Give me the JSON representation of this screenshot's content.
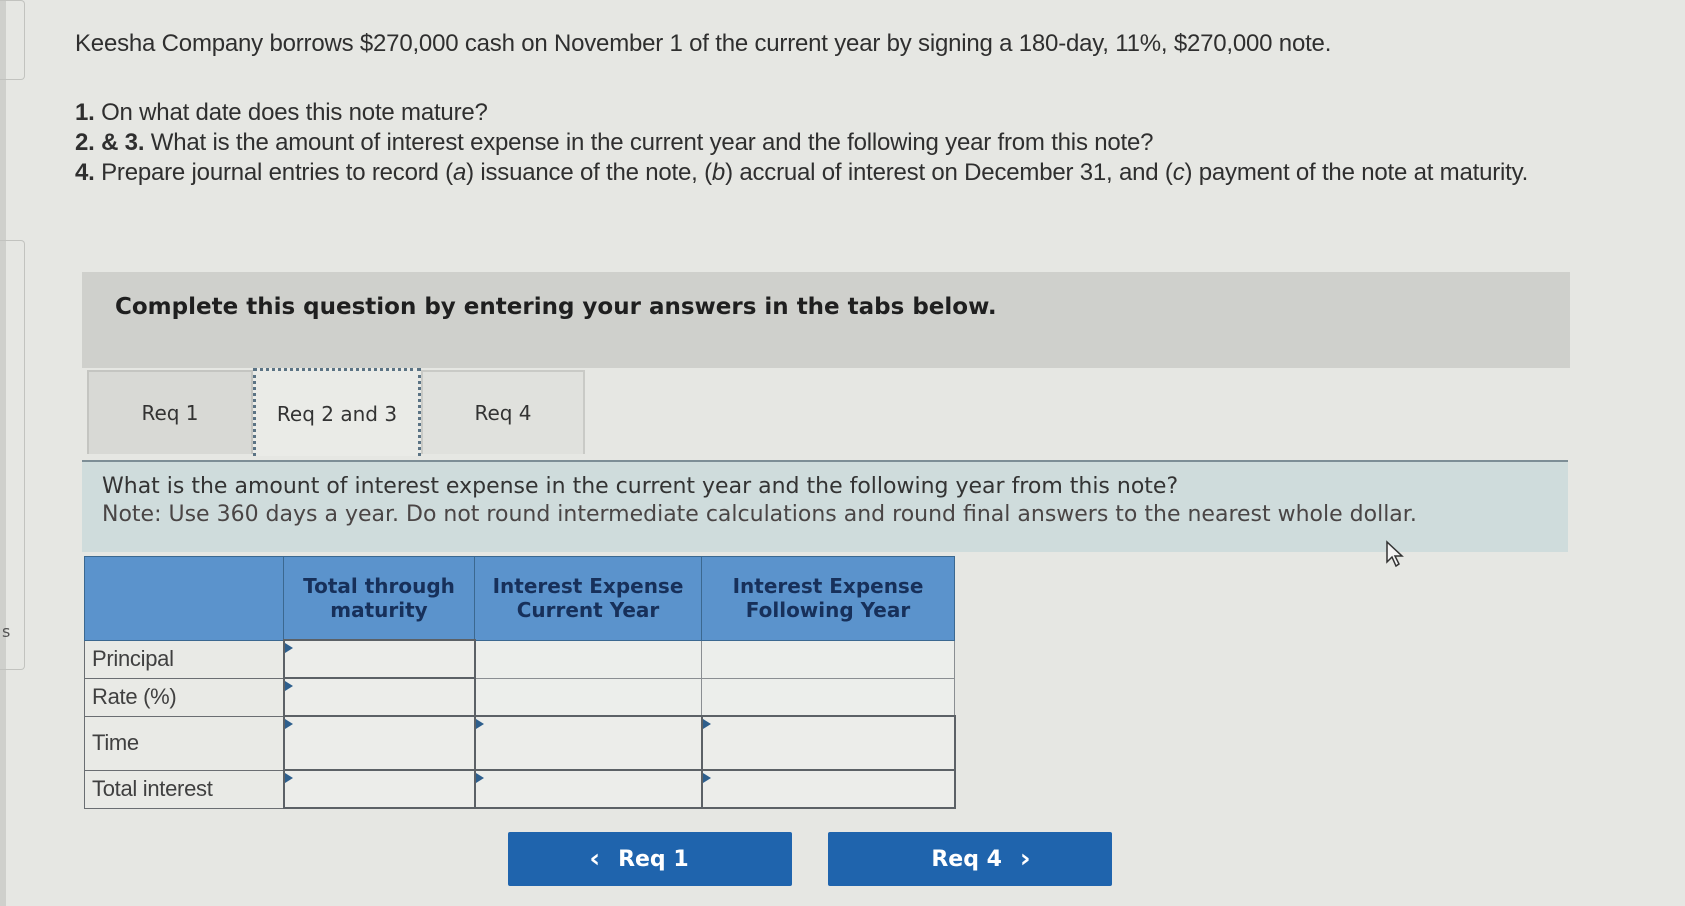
{
  "problem": {
    "intro": "Keesha Company borrows $270,000 cash on November 1 of the current year by signing a 180-day, 11%, $270,000 note.",
    "questions": [
      {
        "num": "1.",
        "text": "On what date does this note mature?"
      },
      {
        "num": "2. & 3.",
        "text": "What is the amount of interest expense in the current year and the following year from this note?"
      },
      {
        "num": "4.",
        "text_parts": [
          "Prepare journal entries to record (",
          "a",
          ") issuance of the note, (",
          "b",
          ") accrual of interest on December 31, and (",
          "c",
          ") payment of the note at maturity."
        ]
      }
    ]
  },
  "instructions": "Complete this question by entering your answers in the tabs below.",
  "tabs": [
    {
      "label": "Req 1",
      "active": false
    },
    {
      "label": "Req 2 and 3",
      "active": true
    },
    {
      "label": "Req 4",
      "active": false
    }
  ],
  "question_panel": {
    "prompt": "What is the amount of interest expense in the current year and the following year from this note?",
    "note": "Note: Use 360 days a year. Do not round intermediate calculations and round final answers to the nearest whole dollar."
  },
  "table": {
    "headers": [
      "",
      "Total through maturity",
      "Interest Expense Current Year",
      "Interest Expense Following Year"
    ],
    "rows": [
      {
        "label": "Principal",
        "values": [
          "",
          "",
          ""
        ]
      },
      {
        "label": "Rate (%)",
        "values": [
          "",
          "",
          ""
        ]
      },
      {
        "label": "Time",
        "values": [
          "",
          "",
          ""
        ]
      },
      {
        "label": "Total interest",
        "values": [
          "",
          "",
          ""
        ]
      }
    ]
  },
  "navigation": {
    "prev_label": "Req 1",
    "next_label": "Req 4",
    "prev_icon": "chevron-left-icon",
    "next_icon": "chevron-right-icon"
  },
  "sidebar_fragment_text": "s",
  "colors": {
    "button_blue": "#1f64ad",
    "header_blue": "#5b93cc",
    "panel_teal": "#cfdcdc"
  }
}
